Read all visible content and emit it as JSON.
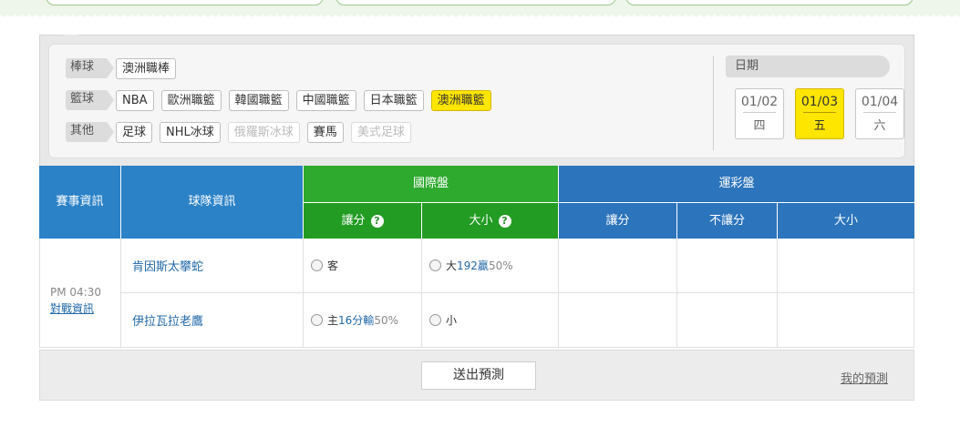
{
  "filters": {
    "rows": [
      {
        "category": "棒球",
        "items": [
          {
            "label": "澳洲職棒",
            "state": "normal"
          }
        ]
      },
      {
        "category": "籃球",
        "items": [
          {
            "label": "NBA",
            "state": "normal"
          },
          {
            "label": "歐洲職籃",
            "state": "normal"
          },
          {
            "label": "韓國職籃",
            "state": "normal"
          },
          {
            "label": "中國職籃",
            "state": "normal"
          },
          {
            "label": "日本職籃",
            "state": "normal"
          },
          {
            "label": "澳洲職籃",
            "state": "active"
          }
        ]
      },
      {
        "category": "其他",
        "items": [
          {
            "label": "足球",
            "state": "normal"
          },
          {
            "label": "NHL冰球",
            "state": "normal"
          },
          {
            "label": "俄羅斯冰球",
            "state": "disabled"
          },
          {
            "label": "賽馬",
            "state": "normal"
          },
          {
            "label": "美式足球",
            "state": "disabled"
          }
        ]
      }
    ]
  },
  "dates": {
    "label": "日期",
    "items": [
      {
        "date": "01/02",
        "weekday": "四",
        "active": false
      },
      {
        "date": "01/03",
        "weekday": "五",
        "active": true
      },
      {
        "date": "01/04",
        "weekday": "六",
        "active": false
      }
    ]
  },
  "table": {
    "headers": {
      "match_info": "賽事資訊",
      "team_info": "球隊資訊",
      "intl": "國際盤",
      "intl_spread": "讓分",
      "intl_total": "大小",
      "help_icon": "?",
      "lottery": "運彩盤",
      "lot_spread": "讓分",
      "lot_nospread": "不讓分",
      "lot_total": "大小"
    },
    "match": {
      "time": "PM 04:30",
      "detail_link": "對戰資訊",
      "away_team": "肯因斯太攀蛇",
      "home_team": "伊拉瓦拉老鷹",
      "away_spread": {
        "label": "客"
      },
      "away_total": {
        "prefix": "大",
        "value": "192",
        "unit": "贏",
        "pct": "50%"
      },
      "home_spread": {
        "prefix": "主",
        "value": "16",
        "unit": "分輸",
        "pct": "50%"
      },
      "home_total": {
        "prefix": "小"
      }
    }
  },
  "footer": {
    "submit": "送出預測",
    "my_predictions": "我的預測"
  },
  "colors": {
    "header_blue": "#2b82c7",
    "header_green": "#2eaa2e",
    "active_yellow": "#ffe600",
    "link_blue": "#2168a8"
  }
}
